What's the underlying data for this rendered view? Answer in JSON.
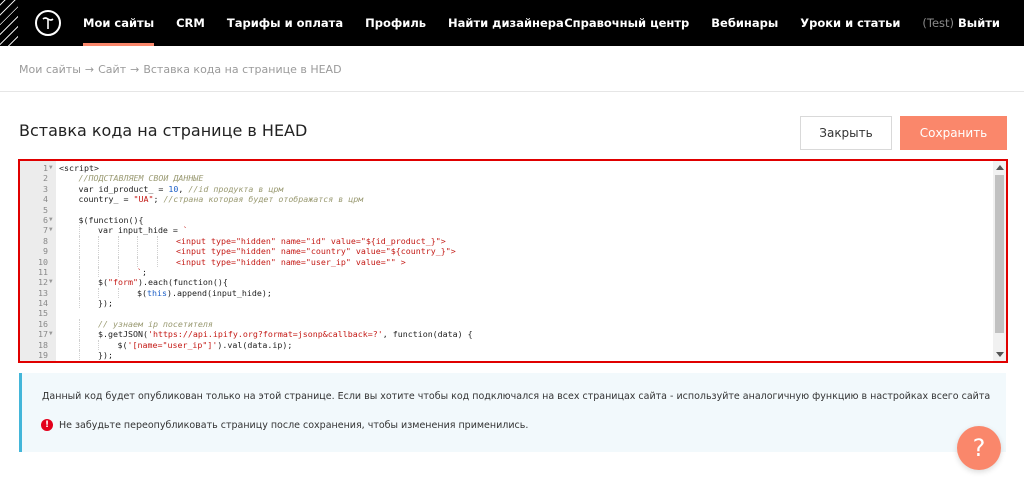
{
  "nav": {
    "left": [
      "Мои сайты",
      "CRM",
      "Тарифы и оплата",
      "Профиль",
      "Найти дизайнера"
    ],
    "right": [
      "Справочный центр",
      "Вебинары",
      "Уроки и статьи"
    ],
    "test_label": "(Test)",
    "logout": "Выйти"
  },
  "breadcrumb": {
    "items": [
      "Мои сайты",
      "Сайт",
      "Вставка кода на странице в HEAD"
    ],
    "separator": "→"
  },
  "page": {
    "title": "Вставка кода на странице в HEAD",
    "close_label": "Закрыть",
    "save_label": "Сохранить"
  },
  "editor": {
    "lines": [
      {
        "n": "1",
        "fold": true,
        "indent": 0,
        "parts": [
          [
            "t",
            "<script>"
          ]
        ]
      },
      {
        "n": "2",
        "fold": false,
        "indent": 1,
        "parts": [
          [
            "cm",
            "//ПОДСТАВЛЯЕМ СВОИ ДАННЫЕ"
          ]
        ]
      },
      {
        "n": "3",
        "fold": false,
        "indent": 1,
        "parts": [
          [
            "t",
            "var id_product_ = "
          ],
          [
            "num",
            "10"
          ],
          [
            "t",
            ", "
          ],
          [
            "cm",
            "//id продукта в црм"
          ]
        ]
      },
      {
        "n": "4",
        "fold": false,
        "indent": 1,
        "parts": [
          [
            "t",
            "country_ = "
          ],
          [
            "str",
            "\"UA\""
          ],
          [
            "t",
            "; "
          ],
          [
            "cm",
            "//страна которая будет отображатся в црм"
          ]
        ]
      },
      {
        "n": "5",
        "fold": false,
        "indent": 0,
        "parts": []
      },
      {
        "n": "6",
        "fold": true,
        "indent": 1,
        "parts": [
          [
            "t",
            "$(function(){"
          ]
        ]
      },
      {
        "n": "7",
        "fold": true,
        "indent": 2,
        "parts": [
          [
            "t",
            "var input_hide = "
          ],
          [
            "str",
            "`"
          ]
        ]
      },
      {
        "n": "8",
        "fold": false,
        "indent": 6,
        "parts": [
          [
            "tag",
            "<input type=\"hidden\" name=\"id\" value=\"${id_product_}\">"
          ]
        ]
      },
      {
        "n": "9",
        "fold": false,
        "indent": 6,
        "parts": [
          [
            "tag",
            "<input type=\"hidden\" name=\"country\" value=\"${country_}\">"
          ]
        ]
      },
      {
        "n": "10",
        "fold": false,
        "indent": 6,
        "parts": [
          [
            "tag",
            "<input type=\"hidden\" name=\"user_ip\" value=\"\" >"
          ]
        ]
      },
      {
        "n": "11",
        "fold": false,
        "indent": 4,
        "parts": [
          [
            "str",
            "`"
          ],
          [
            "t",
            ";"
          ]
        ]
      },
      {
        "n": "12",
        "fold": true,
        "indent": 2,
        "parts": [
          [
            "t",
            "$("
          ],
          [
            "str",
            "\"form\""
          ],
          [
            "t",
            ").each(function(){"
          ]
        ]
      },
      {
        "n": "13",
        "fold": false,
        "indent": 4,
        "parts": [
          [
            "t",
            "$("
          ],
          [
            "num",
            "this"
          ],
          [
            "t",
            ").append(input_hide);"
          ]
        ]
      },
      {
        "n": "14",
        "fold": false,
        "indent": 2,
        "parts": [
          [
            "t",
            "});"
          ]
        ]
      },
      {
        "n": "15",
        "fold": false,
        "indent": 0,
        "parts": []
      },
      {
        "n": "16",
        "fold": false,
        "indent": 2,
        "parts": [
          [
            "cm",
            "// узнаем ip посетителя"
          ]
        ]
      },
      {
        "n": "17",
        "fold": true,
        "indent": 2,
        "parts": [
          [
            "t",
            "$.getJSON("
          ],
          [
            "str",
            "'https://api.ipify.org?format=jsonp&callback=?'"
          ],
          [
            "t",
            ", function(data) {"
          ]
        ]
      },
      {
        "n": "18",
        "fold": false,
        "indent": 3,
        "parts": [
          [
            "t",
            "$("
          ],
          [
            "str",
            "'[name=\"user_ip\"]'"
          ],
          [
            "t",
            ").val(data.ip);"
          ]
        ]
      },
      {
        "n": "19",
        "fold": false,
        "indent": 2,
        "parts": [
          [
            "t",
            "});"
          ]
        ]
      }
    ]
  },
  "info": {
    "text": "Данный код будет опубликован только на этой странице. Если вы хотите чтобы код подключался на всех страницах сайта - используйте аналогичную функцию в настройках всего сайта",
    "warning": "Не забудьте переопубликовать страницу после сохранения, чтобы изменения применились.",
    "warning_mark": "!"
  },
  "help_label": "?",
  "colors": {
    "accent": "#fa876b",
    "editor_border": "#e00000",
    "info_border": "#43b6d9",
    "warning": "#e3001b"
  }
}
